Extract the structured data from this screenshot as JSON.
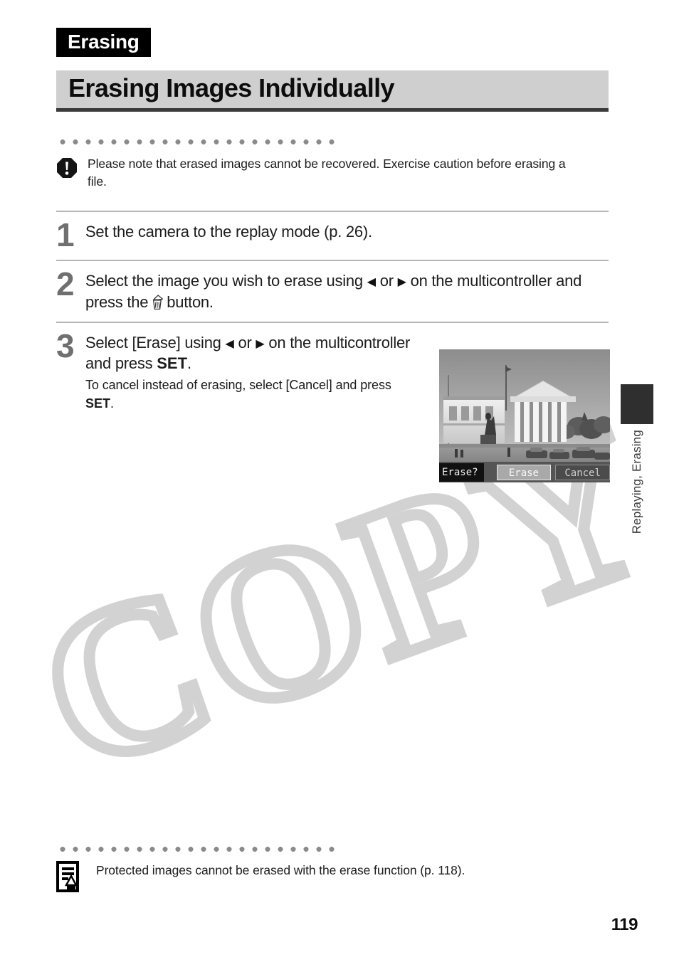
{
  "header": {
    "section_tag": "Erasing",
    "title": "Erasing Images Individually"
  },
  "caution": {
    "icon": "exclamation-octagon-icon",
    "text": "Please note that erased images cannot be recovered. Exercise caution before erasing a file."
  },
  "steps": [
    {
      "number": "1",
      "text_before": "Set the camera to the replay mode (p. 26).",
      "text_after": "",
      "sub": ""
    },
    {
      "number": "2",
      "text_a": "Select the image you wish to erase using",
      "text_b": "or",
      "text_c": "on the multicontroller and press the",
      "text_d": "button.",
      "sub": ""
    },
    {
      "number": "3",
      "text_a": "Select [Erase] using",
      "text_b": "or",
      "text_c": "on the multicontroller and press",
      "set_label": "SET",
      "text_d": ".",
      "sub_a": "To cancel instead of erasing, select [Cancel] and press",
      "sub_set": "SET",
      "sub_b": "."
    }
  ],
  "symbols": {
    "left_arrow": "◀",
    "right_arrow": "▶",
    "erase_icon": "trash-can-icon"
  },
  "lcd": {
    "prompt": "Erase?",
    "confirm_label": "Erase",
    "cancel_label": "Cancel",
    "selected": "Erase"
  },
  "side_index": {
    "label": "Replaying, Erasing"
  },
  "footnote": {
    "icon": "note-pencil-icon",
    "text": "Protected images cannot be erased with the erase function (p. 118)."
  },
  "page_number": "119",
  "watermark": {
    "text": "COPY"
  },
  "colors": {
    "tag_background": "#000000",
    "title_band": "#cfcfcf",
    "title_underline": "#3a3a3a",
    "step_number": "#6f6f6f",
    "rule": "#b5b5b5",
    "dot": "#8a8a8a",
    "side_tab": "#2f2f2f",
    "watermark": "#d2d2d2"
  }
}
